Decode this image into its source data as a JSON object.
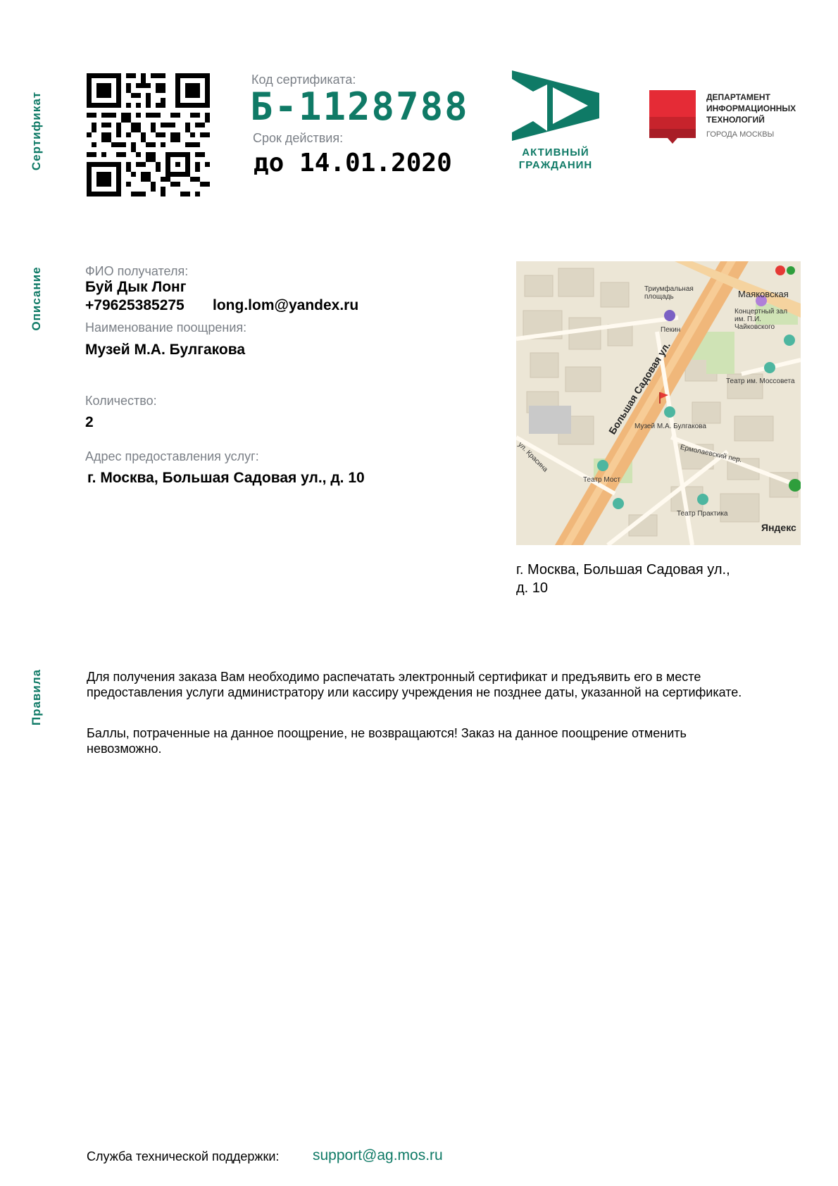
{
  "sections": {
    "certificate": "Сертификат",
    "description": "Описание",
    "rules": "Правила"
  },
  "certificate": {
    "code_label": "Код сертификата:",
    "code": "Б-1128788",
    "validity_label": "Срок действия:",
    "validity": "до 14.01.2020"
  },
  "logos": {
    "active_citizen": "АКТИВНЫЙ ГРАЖДАНИН",
    "dit_line1": "ДЕПАРТАМЕНТ",
    "dit_line2": "ИНФОРМАЦИОННЫХ",
    "dit_line3": "ТЕХНОЛОГИЙ",
    "dit_line4": "ГОРОДА МОСКВЫ",
    "brand_color": "#0f7a66",
    "dit_color": "#e02232"
  },
  "recipient": {
    "name_label": "ФИО получателя:",
    "name": "Буй Дык Лонг",
    "phone": "+79625385275",
    "email": "long.lom@yandex.ru"
  },
  "reward": {
    "label": "Наименование поощрения:",
    "name": "Музей М.А. Булгакова"
  },
  "quantity": {
    "label": "Количество:",
    "value": "2"
  },
  "address": {
    "label": "Адрес предоставления услуг:",
    "value": "г. Москва, Большая Садовая ул., д. 10"
  },
  "map": {
    "caption_line1": "г. Москва, Большая Садовая ул.,",
    "caption_line2": "д. 10",
    "labels": {
      "street": "Большая Садовая ул.",
      "metro": "Маяковская",
      "museum": "Музей М.А. Булгакова",
      "square": "Триумфальная площадь",
      "hotel": "Пекин",
      "concert": "Концертный зал им. П.И. Чайковского",
      "mossovet": "Театр им. Моссовета",
      "most": "Театр Мост",
      "praktika": "Театр Практика",
      "ermolaev": "Ермолаевский пер.",
      "krasina": "ул. Красина",
      "watermark": "Яндекс"
    }
  },
  "rules": {
    "p1": "Для получения заказа Вам необходимо распечатать электронный сертификат и предъявить его в месте предоставления услуги администратору или кассиру учреждения не позднее даты, указанной на сертификате.",
    "p2": "Баллы, потраченные на данное поощрение, не возвращаются! Заказ на данное поощрение отменить невозможно."
  },
  "footer": {
    "support_label": "Служба технической поддержки:",
    "support_email": "support@ag.mos.ru"
  }
}
